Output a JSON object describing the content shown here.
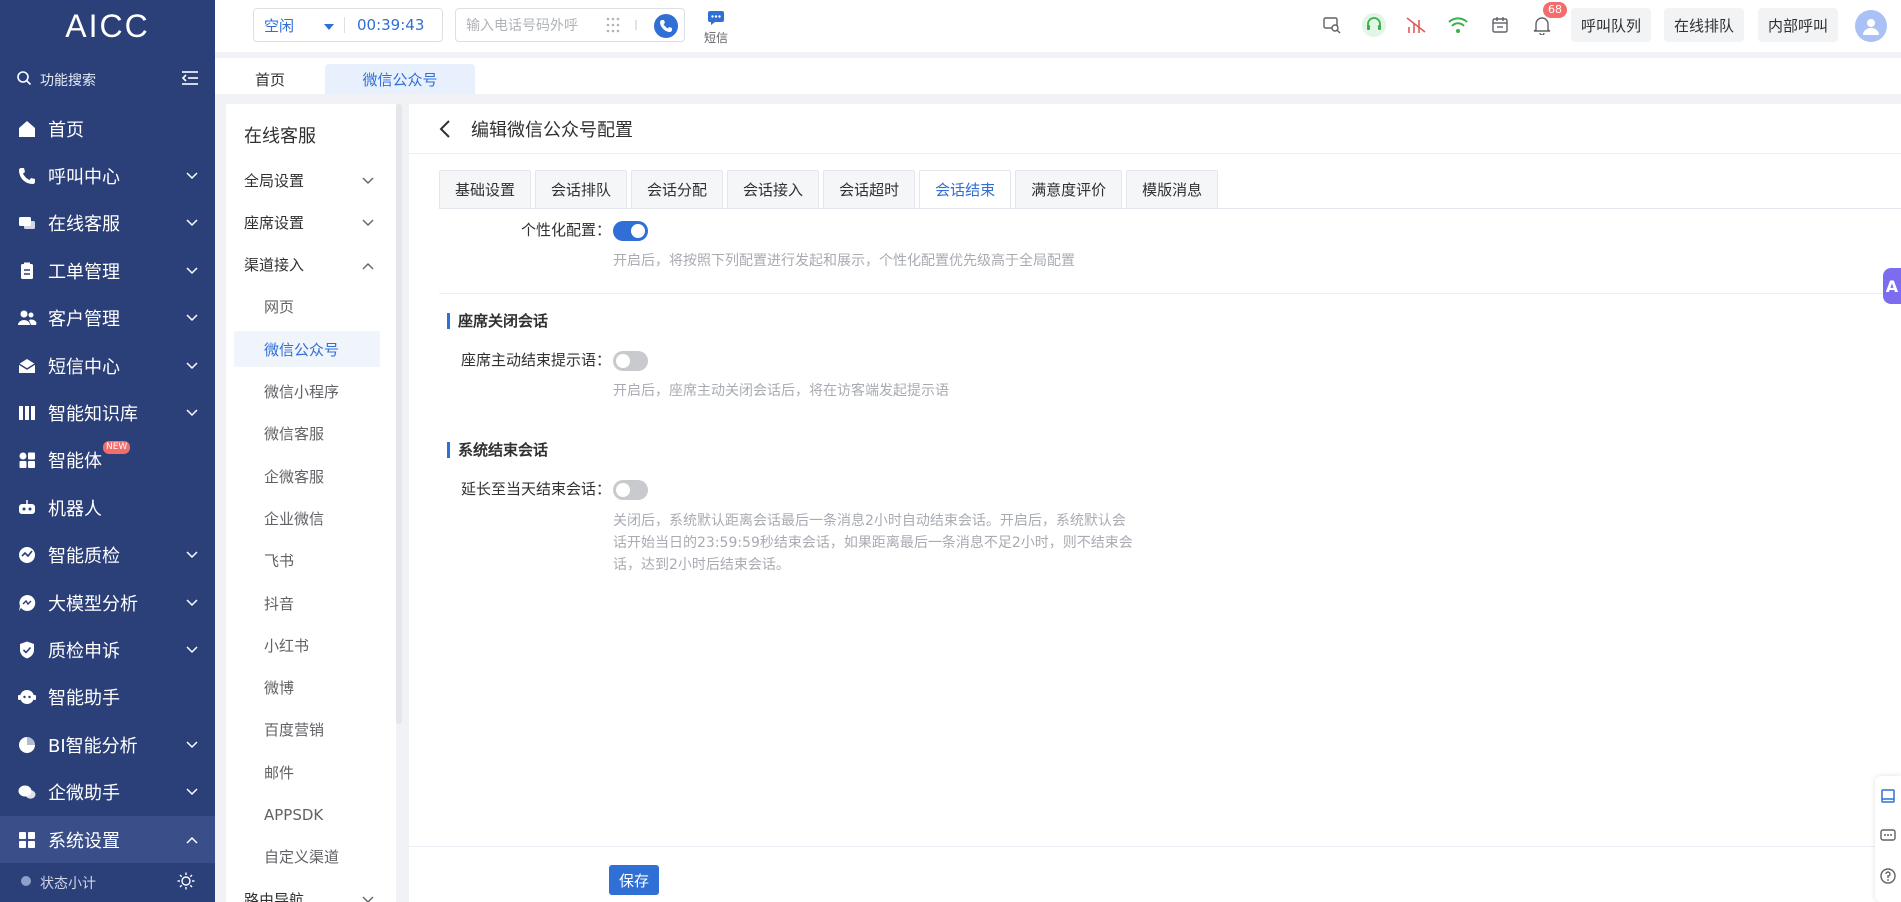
{
  "app": {
    "logo": "AICC"
  },
  "sidebar": {
    "search_label": "功能搜索",
    "items": [
      {
        "label": "首页",
        "icon": "home-icon",
        "has_chevron": false
      },
      {
        "label": "呼叫中心",
        "icon": "phone-icon",
        "has_chevron": true
      },
      {
        "label": "在线客服",
        "icon": "chat-icon",
        "has_chevron": true
      },
      {
        "label": "工单管理",
        "icon": "clipboard-icon",
        "has_chevron": true
      },
      {
        "label": "客户管理",
        "icon": "users-icon",
        "has_chevron": true
      },
      {
        "label": "短信中心",
        "icon": "mail-icon",
        "has_chevron": true
      },
      {
        "label": "智能知识库",
        "icon": "library-icon",
        "has_chevron": true
      },
      {
        "label": "智能体",
        "icon": "grid-icon",
        "has_chevron": false,
        "badge": "NEW"
      },
      {
        "label": "机器人",
        "icon": "robot-icon",
        "has_chevron": false
      },
      {
        "label": "智能质检",
        "icon": "quality-icon",
        "has_chevron": true
      },
      {
        "label": "大模型分析",
        "icon": "model-icon",
        "has_chevron": true
      },
      {
        "label": "质检申诉",
        "icon": "shield-check-icon",
        "has_chevron": true
      },
      {
        "label": "智能助手",
        "icon": "assistant-icon",
        "has_chevron": false
      },
      {
        "label": "BI智能分析",
        "icon": "pie-icon",
        "has_chevron": true
      },
      {
        "label": "企微助手",
        "icon": "wecom-icon",
        "has_chevron": true
      },
      {
        "label": "系统设置",
        "icon": "settings-grid-icon",
        "has_chevron": true,
        "active": true
      }
    ],
    "footer_label": "状态小计"
  },
  "topbar": {
    "status": "空闲",
    "timer": "00:39:43",
    "phone_placeholder": "输入电话号码外呼",
    "sms_label": "短信",
    "notif_count": "68",
    "buttons": [
      "呼叫队列",
      "在线排队",
      "内部呼叫"
    ]
  },
  "page_tabs": [
    "首页",
    "微信公众号"
  ],
  "subnav": {
    "header": "在线客服",
    "items": [
      {
        "label": "全局设置",
        "type": "group",
        "expanded": false
      },
      {
        "label": "座席设置",
        "type": "group",
        "expanded": false
      },
      {
        "label": "渠道接入",
        "type": "group",
        "expanded": true
      },
      {
        "label": "网页",
        "type": "child"
      },
      {
        "label": "微信公众号",
        "type": "child",
        "active": true
      },
      {
        "label": "微信小程序",
        "type": "child"
      },
      {
        "label": "微信客服",
        "type": "child"
      },
      {
        "label": "企微客服",
        "type": "child"
      },
      {
        "label": "企业微信",
        "type": "child"
      },
      {
        "label": "飞书",
        "type": "child"
      },
      {
        "label": "抖音",
        "type": "child"
      },
      {
        "label": "小红书",
        "type": "child"
      },
      {
        "label": "微博",
        "type": "child"
      },
      {
        "label": "百度营销",
        "type": "child"
      },
      {
        "label": "邮件",
        "type": "child"
      },
      {
        "label": "APPSDK",
        "type": "child"
      },
      {
        "label": "自定义渠道",
        "type": "child"
      },
      {
        "label": "路由导航",
        "type": "group",
        "expanded": false
      }
    ]
  },
  "main": {
    "title": "编辑微信公众号配置",
    "tabs": [
      "基础设置",
      "会话排队",
      "会话分配",
      "会话接入",
      "会话超时",
      "会话结束",
      "满意度评价",
      "模版消息"
    ],
    "active_tab": "会话结束",
    "personalize": {
      "label": "个性化配置：",
      "on": true,
      "hint": "开启后，将按照下列配置进行发起和展示，个性化配置优先级高于全局配置"
    },
    "section1": {
      "title": "座席关闭会话",
      "label": "座席主动结束提示语：",
      "on": false,
      "hint": "开启后，座席主动关闭会话后，将在访客端发起提示语"
    },
    "section2": {
      "title": "系统结束会话",
      "label": "延长至当天结束会话：",
      "on": false,
      "hint_lines": [
        "关闭后，系统默认距离会话最后一条消息2小时自动结束会话。开启后，系统默认会",
        "话开始当日的23:59:59秒结束会话，如果距离最后一条消息不足2小时，则不结束会",
        "话，达到2小时后结束会话。"
      ]
    },
    "save_label": "保存"
  },
  "floating": {
    "assistant_letter": "A"
  },
  "colors": {
    "sidebar": "#2b3f78",
    "accent": "#2f6fd6",
    "badge": "#f56c6c"
  }
}
